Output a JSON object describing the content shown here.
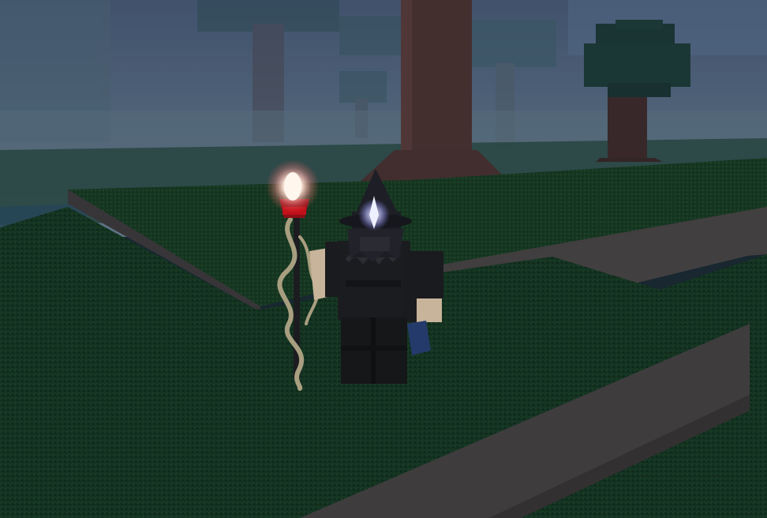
{
  "scene": {
    "colors": {
      "sky_top": "#4a5a78",
      "sky_bottom": "#6b8194",
      "fog": "#5f7584",
      "grass_dark": "#0f2716",
      "grass_mid": "#17381f",
      "grass_light": "#1f4a28",
      "dirt": "#4a4444",
      "dirt_dark": "#3a3434",
      "trunk": "#4e3433",
      "trunk_dark": "#3a2625",
      "foliage": "#1e3a36",
      "robe": "#1a1b1f",
      "robe_shade": "#111215",
      "skin": "#c8b49a",
      "staff": "#1c1c20",
      "vine": "#a89e80",
      "orb_glow": "#ffe9e0",
      "orb_red": "#c0101a",
      "hat_glow": "#d8d8ff",
      "book": "#243a6a"
    }
  }
}
